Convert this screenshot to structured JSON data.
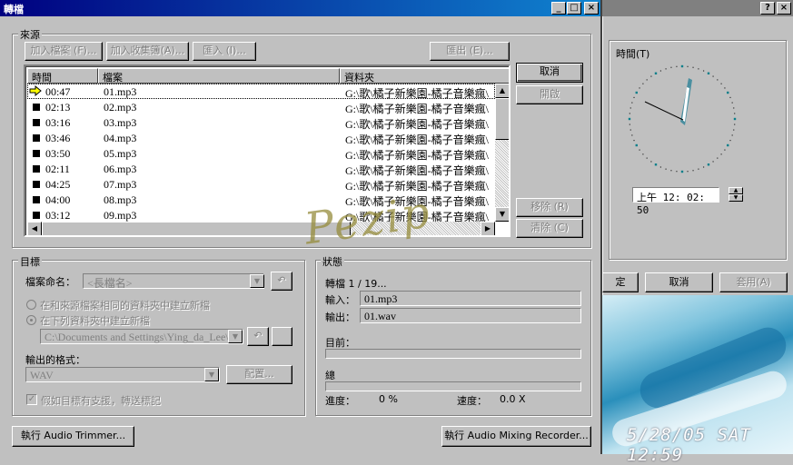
{
  "background": {
    "clock_window": {
      "help_btn": "?",
      "close_btn": "×",
      "group_label": "時間(T)",
      "time_value": "上午   12: 02: 50",
      "ok_label": "定",
      "cancel_label": "取消",
      "apply_label": "套用(A)"
    },
    "photo_datestamp": "5/28/05  SAT 12:59"
  },
  "dialog": {
    "title": "轉檔",
    "source": {
      "group_label": "來源",
      "add_file": "加入檔案 (F)...",
      "add_playlist": "加入收集簿(A)...",
      "import": "匯入 (I)...",
      "export": "匯出 (E)...",
      "columns": [
        "時間",
        "檔案",
        "資料夾"
      ],
      "rows": [
        {
          "time": "00:47",
          "file": "01.mp3",
          "folder": "G:\\歌\\橘子新樂園-橘子音樂瘋\\"
        },
        {
          "time": "02:13",
          "file": "02.mp3",
          "folder": "G:\\歌\\橘子新樂園-橘子音樂瘋\\"
        },
        {
          "time": "03:16",
          "file": "03.mp3",
          "folder": "G:\\歌\\橘子新樂園-橘子音樂瘋\\"
        },
        {
          "time": "03:46",
          "file": "04.mp3",
          "folder": "G:\\歌\\橘子新樂園-橘子音樂瘋\\"
        },
        {
          "time": "03:50",
          "file": "05.mp3",
          "folder": "G:\\歌\\橘子新樂園-橘子音樂瘋\\"
        },
        {
          "time": "02:11",
          "file": "06.mp3",
          "folder": "G:\\歌\\橘子新樂園-橘子音樂瘋\\"
        },
        {
          "time": "04:25",
          "file": "07.mp3",
          "folder": "G:\\歌\\橘子新樂園-橘子音樂瘋\\"
        },
        {
          "time": "04:00",
          "file": "08.mp3",
          "folder": "G:\\歌\\橘子新樂園-橘子音樂瘋\\"
        },
        {
          "time": "03:12",
          "file": "09.mp3",
          "folder": "G:\\歌\\橘子新樂園-橘子音樂瘋\\"
        }
      ],
      "cancel": "取消",
      "open": "開啟",
      "remove": "移除 (R)",
      "clear": "清除 (C)"
    },
    "target": {
      "group_label": "目標",
      "naming_label": "檔案命名：",
      "naming_value": "<長檔名>",
      "radio_same": "在和來源檔案相同的資料夾中建立新檔",
      "radio_folder": "在下列資料夾中建立新檔",
      "folder_value": "C:\\Documents and Settings\\Ying_da_Lee\\M",
      "format_label": "輸出的格式：",
      "format_value": "WAV",
      "config": "配置...",
      "check_label": "假如目標有支援，轉送標記"
    },
    "status": {
      "group_label": "狀態",
      "progress_text": "轉檔 1 / 19...",
      "input_label": "輸入：",
      "input_value": "01.mp3",
      "output_label": "輸出：",
      "output_value": "01.wav",
      "current_label": "目前：",
      "total_label": "總",
      "current_fraction": 0,
      "total_fraction": 0,
      "progress_label": "進度：",
      "progress_value": "0 %",
      "speed_label": "速度：",
      "speed_value": "0.0 X"
    },
    "trimmer_button": "執行 Audio Trimmer...",
    "mixing_button": "執行 Audio Mixing Recorder..."
  },
  "watermark": "Pezip"
}
